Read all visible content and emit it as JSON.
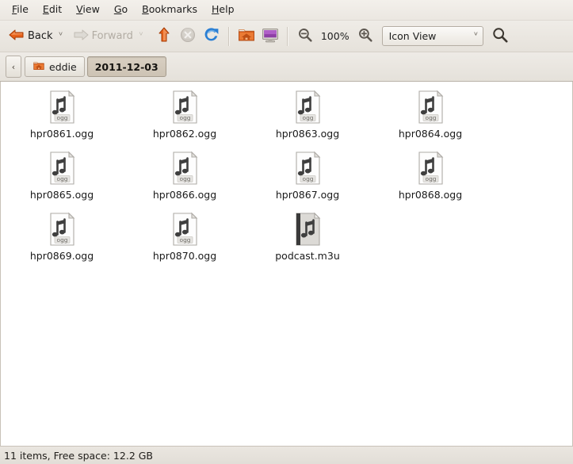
{
  "menubar": {
    "items": [
      {
        "label": "File",
        "mnemonic": "F"
      },
      {
        "label": "Edit",
        "mnemonic": "E"
      },
      {
        "label": "View",
        "mnemonic": "V"
      },
      {
        "label": "Go",
        "mnemonic": "G"
      },
      {
        "label": "Bookmarks",
        "mnemonic": "B"
      },
      {
        "label": "Help",
        "mnemonic": "H"
      }
    ]
  },
  "toolbar": {
    "back_label": "Back",
    "back_icon": "arrow-left-icon",
    "back_caret": "ⱽ",
    "forward_label": "Forward",
    "forward_icon": "arrow-right-icon",
    "forward_caret": "ⱽ",
    "up_icon": "arrow-up-icon",
    "stop_icon": "stop-icon",
    "reload_icon": "reload-icon",
    "home_icon": "home-folder-icon",
    "computer_icon": "computer-icon",
    "zoom_out_icon": "zoom-out-icon",
    "zoom_level": "100%",
    "zoom_in_icon": "zoom-in-icon",
    "view_mode": "Icon View",
    "view_caret": "ⱽ",
    "search_icon": "search-icon"
  },
  "pathbar": {
    "scroll_left": "‹",
    "crumbs": [
      {
        "label": "eddie",
        "icon": "home-folder-icon",
        "current": false
      },
      {
        "label": "2011-12-03",
        "icon": "",
        "current": true
      }
    ]
  },
  "content": {
    "files": [
      {
        "name": "hpr0861.ogg",
        "type": "ogg",
        "badge": "ogg"
      },
      {
        "name": "hpr0862.ogg",
        "type": "ogg",
        "badge": "ogg"
      },
      {
        "name": "hpr0863.ogg",
        "type": "ogg",
        "badge": "ogg"
      },
      {
        "name": "hpr0864.ogg",
        "type": "ogg",
        "badge": "ogg"
      },
      {
        "name": "hpr0865.ogg",
        "type": "ogg",
        "badge": "ogg"
      },
      {
        "name": "hpr0866.ogg",
        "type": "ogg",
        "badge": "ogg"
      },
      {
        "name": "hpr0867.ogg",
        "type": "ogg",
        "badge": "ogg"
      },
      {
        "name": "hpr0868.ogg",
        "type": "ogg",
        "badge": "ogg"
      },
      {
        "name": "hpr0869.ogg",
        "type": "ogg",
        "badge": "ogg"
      },
      {
        "name": "hpr0870.ogg",
        "type": "ogg",
        "badge": "ogg"
      },
      {
        "name": "podcast.m3u",
        "type": "m3u",
        "badge": ""
      }
    ]
  },
  "statusbar": {
    "text": "11 items, Free space: 12.2 GB"
  },
  "colors": {
    "accent_orange": "#e8621a",
    "reload_blue": "#2a7fd4",
    "chrome": "#e8e4dd",
    "content_bg": "#ffffff",
    "text": "#1d1d1d"
  }
}
